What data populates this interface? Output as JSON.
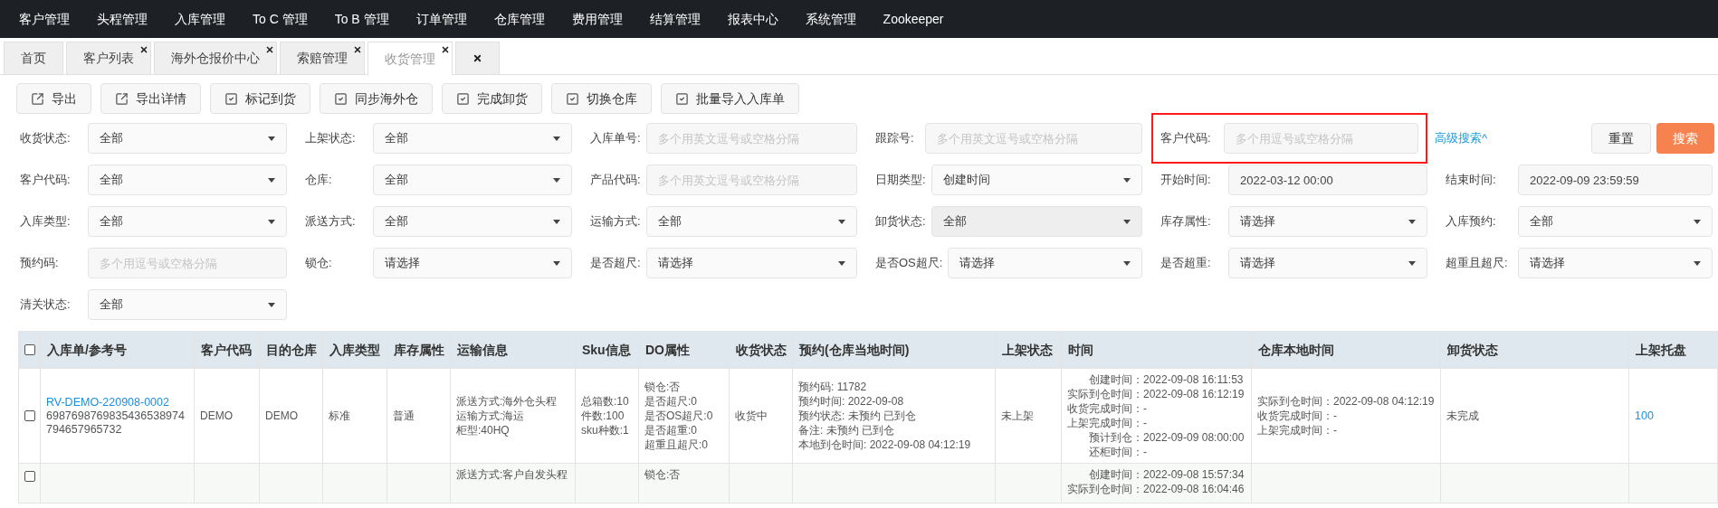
{
  "nav": [
    "客户管理",
    "头程管理",
    "入库管理",
    "To C 管理",
    "To B 管理",
    "订单管理",
    "仓库管理",
    "费用管理",
    "结算管理",
    "报表中心",
    "系统管理",
    "Zookeeper"
  ],
  "tabs": [
    {
      "label": "首页",
      "closable": false,
      "selected": false
    },
    {
      "label": "客户列表",
      "closable": true,
      "selected": false
    },
    {
      "label": "海外仓报价中心",
      "closable": true,
      "selected": false
    },
    {
      "label": "索赔管理",
      "closable": true,
      "selected": false
    },
    {
      "label": "收货管理",
      "closable": true,
      "selected": true
    },
    {
      "closable": true,
      "selected": false
    }
  ],
  "toolbar": [
    {
      "label": "导出",
      "kind": "export"
    },
    {
      "label": "导出详情",
      "kind": "export"
    },
    {
      "label": "标记到货",
      "kind": "check"
    },
    {
      "label": "同步海外仓",
      "kind": "check"
    },
    {
      "label": "完成卸货",
      "kind": "check"
    },
    {
      "label": "切换仓库",
      "kind": "check"
    },
    {
      "label": "批量导入入库单",
      "kind": "check"
    }
  ],
  "filter_rows": [
    [
      {
        "label": "收货状态:",
        "kind": "select",
        "value": "全部"
      },
      {
        "label": "上架状态:",
        "kind": "select",
        "value": "全部"
      },
      {
        "label": "入库单号:",
        "kind": "input",
        "placeholder": "多个用英文逗号或空格分隔"
      },
      {
        "label": "跟踪号:",
        "kind": "input",
        "placeholder": "多个用英文逗号或空格分隔"
      },
      {
        "label": "客户代码:",
        "kind": "input",
        "placeholder": "多个用逗号或空格分隔",
        "highlighted": true
      }
    ],
    [
      {
        "label": "客户代码:",
        "kind": "select",
        "value": "全部"
      },
      {
        "label": "仓库:",
        "kind": "select",
        "value": "全部"
      },
      {
        "label": "产品代码:",
        "kind": "input",
        "placeholder": "多个用英文逗号或空格分隔"
      },
      {
        "label": "日期类型:",
        "kind": "select",
        "value": "创建时间"
      },
      {
        "label": "开始时间:",
        "kind": "input",
        "value": "2022-03-12 00:00"
      },
      {
        "label": "结束时间:",
        "kind": "input",
        "value": "2022-09-09 23:59:59"
      }
    ],
    [
      {
        "label": "入库类型:",
        "kind": "select",
        "value": "全部"
      },
      {
        "label": "派送方式:",
        "kind": "select",
        "value": "全部"
      },
      {
        "label": "运输方式:",
        "kind": "select",
        "value": "全部"
      },
      {
        "label": "卸货状态:",
        "kind": "select",
        "value": "全部",
        "disabled": true
      },
      {
        "label": "库存属性:",
        "kind": "select",
        "value": "请选择"
      },
      {
        "label": "入库预约:",
        "kind": "select",
        "value": "全部"
      }
    ],
    [
      {
        "label": "预约码:",
        "kind": "input",
        "placeholder": "多个用逗号或空格分隔"
      },
      {
        "label": "锁仓:",
        "kind": "select",
        "value": "请选择"
      },
      {
        "label": "是否超尺:",
        "kind": "select",
        "value": "请选择"
      },
      {
        "label": "是否OS超尺:",
        "kind": "select",
        "value": "请选择"
      },
      {
        "label": "是否超重:",
        "kind": "select",
        "value": "请选择"
      },
      {
        "label": "超重且超尺:",
        "kind": "select",
        "value": "请选择"
      }
    ],
    [
      {
        "label": "清关状态:",
        "kind": "select",
        "value": "全部"
      }
    ]
  ],
  "advanced_search": "高级搜索^",
  "reset_button": "重置",
  "search_button": "搜索",
  "table": {
    "select_all_checked": false,
    "columns": [
      "入库单/参考号",
      "客户代码",
      "目的仓库",
      "入库类型",
      "库存属性",
      "运输信息",
      "Sku信息",
      "DO属性",
      "收货状态",
      "预约(仓库当地时间)",
      "上架状态",
      "时间",
      "仓库本地时间",
      "卸货状态",
      "上架托盘"
    ],
    "rows": [
      {
        "checked": false,
        "cells": [
          {
            "links": [
              "RV-DEMO-220908-0002"
            ],
            "lines": [
              "6987698769835436538974794657965732"
            ]
          },
          {
            "lines": [
              "DEMO"
            ]
          },
          {
            "lines": [
              "DEMO"
            ]
          },
          {
            "lines": [
              "标准"
            ]
          },
          {
            "lines": [
              "普通"
            ]
          },
          {
            "lines": [
              "派送方式:海外仓头程",
              "运输方式:海运",
              "柜型:40HQ"
            ]
          },
          {
            "lines": [
              "总箱数:10",
              "件数:100",
              "sku种数:1"
            ]
          },
          {
            "lines": [
              "锁仓:否",
              "是否超尺:0",
              "是否OS超尺:0",
              "是否超重:0",
              "超重且超尺:0"
            ]
          },
          {
            "lines": [
              "收货中"
            ]
          },
          {
            "lines": [
              "预约码: 11782",
              "预约时间: 2022-09-08",
              "预约状态: 未预约 已到仓",
              "备注: 未预约 已到仓",
              "本地到仓时间: 2022-09-08 04:12:19"
            ]
          },
          {
            "lines": [
              "未上架"
            ]
          },
          {
            "pairs": [
              [
                "创建时间：",
                "2022-09-08 16:11:53"
              ],
              [
                "实际到仓时间：",
                "2022-09-08 16:12:19"
              ],
              [
                "收货完成时间：",
                "-"
              ],
              [
                "上架完成时间：",
                "-"
              ],
              [
                "预计到仓：",
                "2022-09-09 08:00:00"
              ],
              [
                "还柜时间：",
                "-"
              ]
            ]
          },
          {
            "lines": [
              "实际到仓时间：2022-09-08 04:12:19",
              "收货完成时间：-",
              "上架完成时间：-"
            ]
          },
          {
            "lines": [
              "未完成"
            ]
          },
          {
            "links": [
              "100"
            ]
          }
        ]
      },
      {
        "checked": false,
        "cells": [
          {},
          {},
          {},
          {},
          {},
          {
            "lines": [
              "派送方式:客户自发头程"
            ]
          },
          {},
          {
            "lines": [
              "锁仓:否"
            ]
          },
          {},
          {},
          {},
          {
            "pairs": [
              [
                "创建时间：",
                "2022-09-08 15:57:34"
              ],
              [
                "实际到仓时间：",
                "2022-09-08 16:04:46"
              ]
            ]
          },
          {},
          {},
          {}
        ]
      }
    ]
  }
}
